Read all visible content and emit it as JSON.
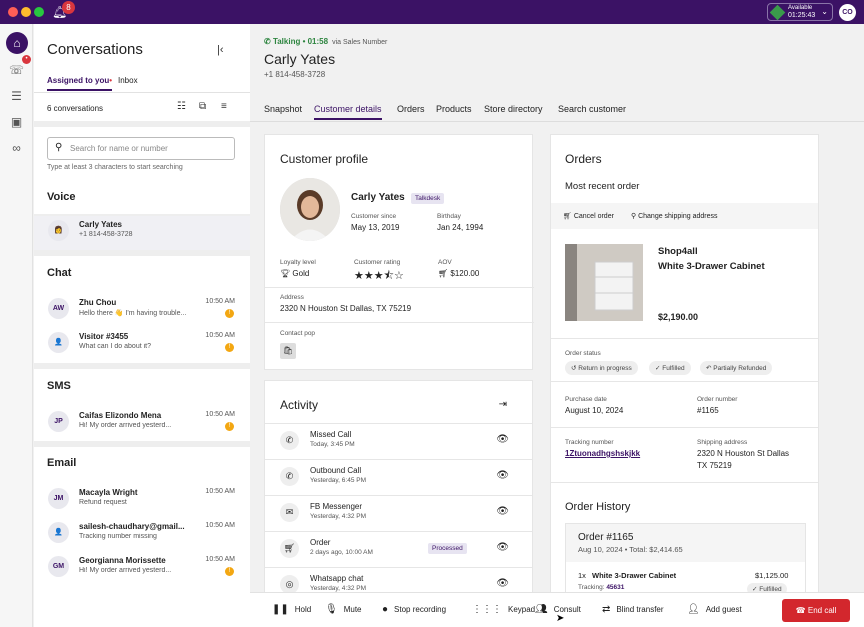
{
  "topbar": {
    "notification_count": "8",
    "status_label": "Available",
    "status_timer": "01:25:43",
    "user_initials": "CO"
  },
  "conversations": {
    "title": "Conversations",
    "tabs": [
      {
        "label": "Assigned to you",
        "indicator": "•"
      },
      {
        "label": "Inbox"
      }
    ],
    "count_label": "6 conversations",
    "search_placeholder": "Search for name or number",
    "search_hint": "Type at least 3 characters to start searching",
    "sections": {
      "voice": "Voice",
      "chat": "Chat",
      "sms": "SMS",
      "email": "Email"
    },
    "voice_items": [
      {
        "name": "Carly Yates",
        "sub": "+1 814-458-3728"
      }
    ],
    "chat_items": [
      {
        "initials": "AW",
        "name": "Zhu Chou",
        "sub": "Hello there 👋 I'm having trouble...",
        "time": "10:50 AM",
        "badge": "!"
      },
      {
        "initials": "",
        "name": "Visitor #3455",
        "sub": "What can I do about it?",
        "time": "10:50 AM",
        "badge": "!"
      }
    ],
    "sms_items": [
      {
        "initials": "JP",
        "name": "Caifas Elizondo Mena",
        "sub": "Hi! My order arrived yesterd...",
        "time": "10:50 AM",
        "badge": "!"
      }
    ],
    "email_items": [
      {
        "initials": "JM",
        "name": "Macayla Wright",
        "sub": "Refund request",
        "time": "10:50 AM"
      },
      {
        "initials": "",
        "name": "sailesh-chaudhary@gmail...",
        "sub": "Tracking number missing",
        "time": "10:50 AM"
      },
      {
        "initials": "GM",
        "name": "Georgianna Morissette",
        "sub": "Hi! My order arrived yesterd...",
        "time": "10:50 AM",
        "badge": "!"
      }
    ]
  },
  "call": {
    "status": "Talking • 01:58",
    "via": "via Sales Number",
    "name": "Carly Yates",
    "phone": "+1 814-458-3728"
  },
  "tabs": [
    "Snapshot",
    "Customer details",
    "Orders",
    "Products",
    "Store directory",
    "Search customer"
  ],
  "profile": {
    "title": "Customer profile",
    "name": "Carly Yates",
    "source_tag": "Talkdesk",
    "since_label": "Customer since",
    "since": "May 13, 2019",
    "birthday_label": "Birthday",
    "birthday": "Jan 24, 1994",
    "loyalty_label": "Loyalty level",
    "loyalty": "Gold",
    "rating_label": "Customer rating",
    "rating": 3.5,
    "aov_label": "AOV",
    "aov": "$120.00",
    "address_label": "Address",
    "address": "2320 N Houston St Dallas, TX 75219",
    "contact_pop_label": "Contact pop"
  },
  "activity": {
    "title": "Activity",
    "items": [
      {
        "name": "Missed Call",
        "time": "Today, 3:45 PM",
        "icon": "missed-call-icon"
      },
      {
        "name": "Outbound Call",
        "time": "Yesterday, 6:45 PM",
        "icon": "phone-outbound-icon"
      },
      {
        "name": "FB Messenger",
        "time": "Yesterday, 4:32 PM",
        "icon": "messenger-icon"
      },
      {
        "name": "Order",
        "time": "2 days ago, 10:00 AM",
        "icon": "cart-icon",
        "tag": "Processed"
      },
      {
        "name": "Whatsapp chat",
        "time": "Yesterday, 4:32 PM",
        "icon": "whatsapp-icon"
      }
    ]
  },
  "orders": {
    "title": "Orders",
    "recent_label": "Most recent order",
    "cancel_label": "Cancel order",
    "change_address_label": "Change shipping address",
    "store": "Shop4all",
    "product": "White 3-Drawer Cabinet",
    "price": "$2,190.00",
    "status_label": "Order status",
    "statuses": [
      "Return in progress",
      "Fulfilled",
      "Partially Refunded"
    ],
    "purchase_date_label": "Purchase date",
    "purchase_date": "August 10, 2024",
    "order_number_label": "Order number",
    "order_number": "#1165",
    "tracking_label": "Tracking number",
    "tracking": "1Ztuonadhgshskjkk",
    "shipping_label": "Shipping address",
    "shipping_line1": "2320 N Houston St Dallas",
    "shipping_line2": "TX 75219",
    "history_title": "Order History",
    "history": {
      "order": "Order #1165",
      "meta": "Aug 10, 2024 • Total: $2,414.65",
      "qty": "1x",
      "item": "White 3-Drawer Cabinet",
      "item_price": "$1,125.00",
      "tracking_label": "Tracking:",
      "tracking": "45631",
      "status": "Fulfilled"
    }
  },
  "controls": {
    "hold": "Hold",
    "mute": "Mute",
    "stop_recording": "Stop recording",
    "keypad": "Keypad",
    "consult": "Consult",
    "blind_transfer": "Blind transfer",
    "add_guest": "Add guest",
    "end_call": "End call"
  }
}
